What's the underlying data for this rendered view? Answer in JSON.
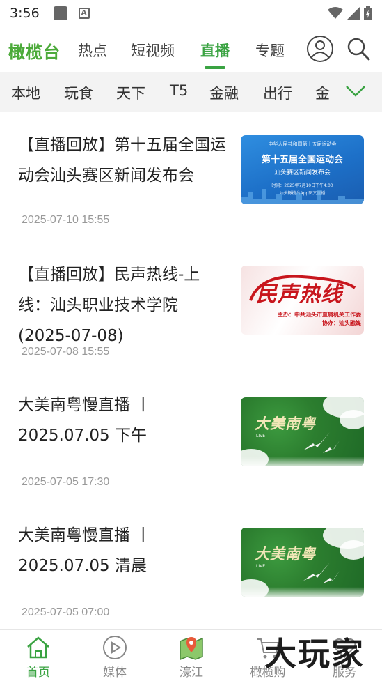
{
  "status_bar": {
    "time": "3:56",
    "icons": [
      "app-icon",
      "text-a-icon",
      "wifi-icon",
      "signal-icon",
      "battery-icon"
    ]
  },
  "top_nav": {
    "brand": "橄榄台",
    "tabs": [
      {
        "label": "热点",
        "active": false
      },
      {
        "label": "短视频",
        "active": false
      },
      {
        "label": "直播",
        "active": true
      },
      {
        "label": "专题",
        "active": false
      }
    ],
    "icons": [
      "user-icon",
      "search-icon"
    ]
  },
  "categories": {
    "items": [
      "本地",
      "玩食",
      "天下",
      "T5",
      "金融",
      "出行",
      "金"
    ],
    "expand_icon": "chevron-down-icon"
  },
  "feed": [
    {
      "title": "【直播回放】第十五届全国运动会汕头赛区新闻发布会",
      "date": "2025-07-10 15:55",
      "thumb": {
        "style": "blue",
        "small": "中华人民共和国第十五届运动会",
        "big": "第十五届全国运动会",
        "mid": "汕头赛区新闻发布会",
        "meta": "时间：2025年7月10日下午4:00",
        "meta2": "汕头橄榄台App图文直播"
      }
    },
    {
      "title": "【直播回放】民声热线-上线：汕头职业技术学院(2025-07-08)",
      "date": "2025-07-08 15:55",
      "thumb": {
        "style": "red",
        "big": "民声热线",
        "line1": "主办：中共汕头市直属机关工作委",
        "line2": "协办：汕头融媒"
      }
    },
    {
      "title": "大美南粤慢直播 丨 2025.07.05 下午",
      "date": "2025-07-05 17:30",
      "thumb": {
        "style": "green",
        "big": "大美南粤",
        "live": "LIVE"
      }
    },
    {
      "title": "大美南粤慢直播 丨 2025.07.05 清晨",
      "date": "2025-07-05 07:00",
      "thumb": {
        "style": "green",
        "big": "大美南粤",
        "live": "LIVE"
      }
    }
  ],
  "bottom_nav": [
    {
      "label": "首页",
      "icon": "home-icon",
      "active": true
    },
    {
      "label": "媒体",
      "icon": "play-circle-icon",
      "active": false
    },
    {
      "label": "濠江",
      "icon": "map-icon",
      "active": false
    },
    {
      "label": "橄榄购",
      "icon": "cart-icon",
      "active": false
    },
    {
      "label": "服务",
      "icon": "heart-icon",
      "active": false
    }
  ],
  "watermark": "大玩家",
  "colors": {
    "accent": "#3aa342",
    "brand": "#4caa3a",
    "date_text": "#999999"
  }
}
